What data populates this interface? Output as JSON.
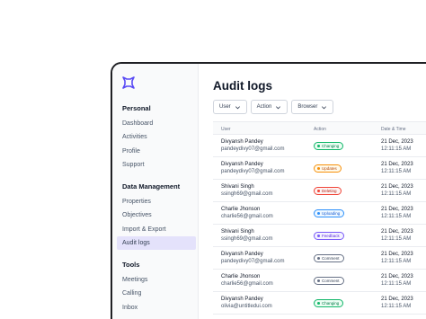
{
  "sidebar": {
    "groups": [
      {
        "title": "Personal",
        "items": [
          "Dashboard",
          "Activities",
          "Profile",
          "Support"
        ]
      },
      {
        "title": "Data Management",
        "items": [
          "Properties",
          "Objectives",
          "Import & Export",
          "Audit logs"
        ]
      },
      {
        "title": "Tools",
        "items": [
          "Meetings",
          "Calling",
          "Inbox"
        ]
      }
    ],
    "active": "Audit logs"
  },
  "page": {
    "title": "Audit logs"
  },
  "filters": [
    "User",
    "Action",
    "Browser"
  ],
  "table": {
    "headers": {
      "user": "User",
      "action": "Action",
      "date": "Date & Time"
    },
    "rows": [
      {
        "name": "Divyansh Pandey",
        "email": "pandeydivy07@gmail.com",
        "action": "Changing",
        "color": "#12b76a",
        "bg": "#ecfdf3",
        "fg": "#027a48",
        "date": "21 Dec, 2023",
        "time": "12:11:15 AM"
      },
      {
        "name": "Divyansh Pandey",
        "email": "pandeydivy07@gmail.com",
        "action": "Updates",
        "color": "#f79009",
        "bg": "#fffaeb",
        "fg": "#b54708",
        "date": "21 Dec, 2023",
        "time": "12:11:15 AM"
      },
      {
        "name": "Shivani Singh",
        "email": "ssingh69@gmail.com",
        "action": "Deleting",
        "color": "#f04438",
        "bg": "#fef3f2",
        "fg": "#b42318",
        "date": "21 Dec, 2023",
        "time": "12:11:15 AM"
      },
      {
        "name": "Charlie Jhonson",
        "email": "charlie56@gmail.com",
        "action": "Uploading",
        "color": "#2e90fa",
        "bg": "#eff8ff",
        "fg": "#175cd3",
        "date": "21 Dec, 2023",
        "time": "12:11:15 AM"
      },
      {
        "name": "Shivani Singh",
        "email": "ssingh69@gmail.com",
        "action": "Feedback",
        "color": "#7a5af8",
        "bg": "#f4f3ff",
        "fg": "#5925dc",
        "date": "21 Dec, 2023",
        "time": "12:11:15 AM"
      },
      {
        "name": "Divyansh Pandey",
        "email": "pandeydivy07@gmail.com",
        "action": "Comment",
        "color": "#667085",
        "bg": "#ffffff",
        "fg": "#344054",
        "date": "21 Dec, 2023",
        "time": "12:11:15 AM"
      },
      {
        "name": "Charlie Jhonson",
        "email": "charlie56@gmail.com",
        "action": "Comment",
        "color": "#667085",
        "bg": "#ffffff",
        "fg": "#344054",
        "date": "21 Dec, 2023",
        "time": "12:11:15 AM"
      },
      {
        "name": "Divyansh Pandey",
        "email": "olivia@untitledui.com",
        "action": "Changing",
        "color": "#12b76a",
        "bg": "#ecfdf3",
        "fg": "#027a48",
        "date": "21 Dec, 2023",
        "time": "12:11:15 AM"
      }
    ]
  },
  "colors": {
    "accent": "#5b4cf5",
    "active_bg": "#e4e2fb"
  }
}
